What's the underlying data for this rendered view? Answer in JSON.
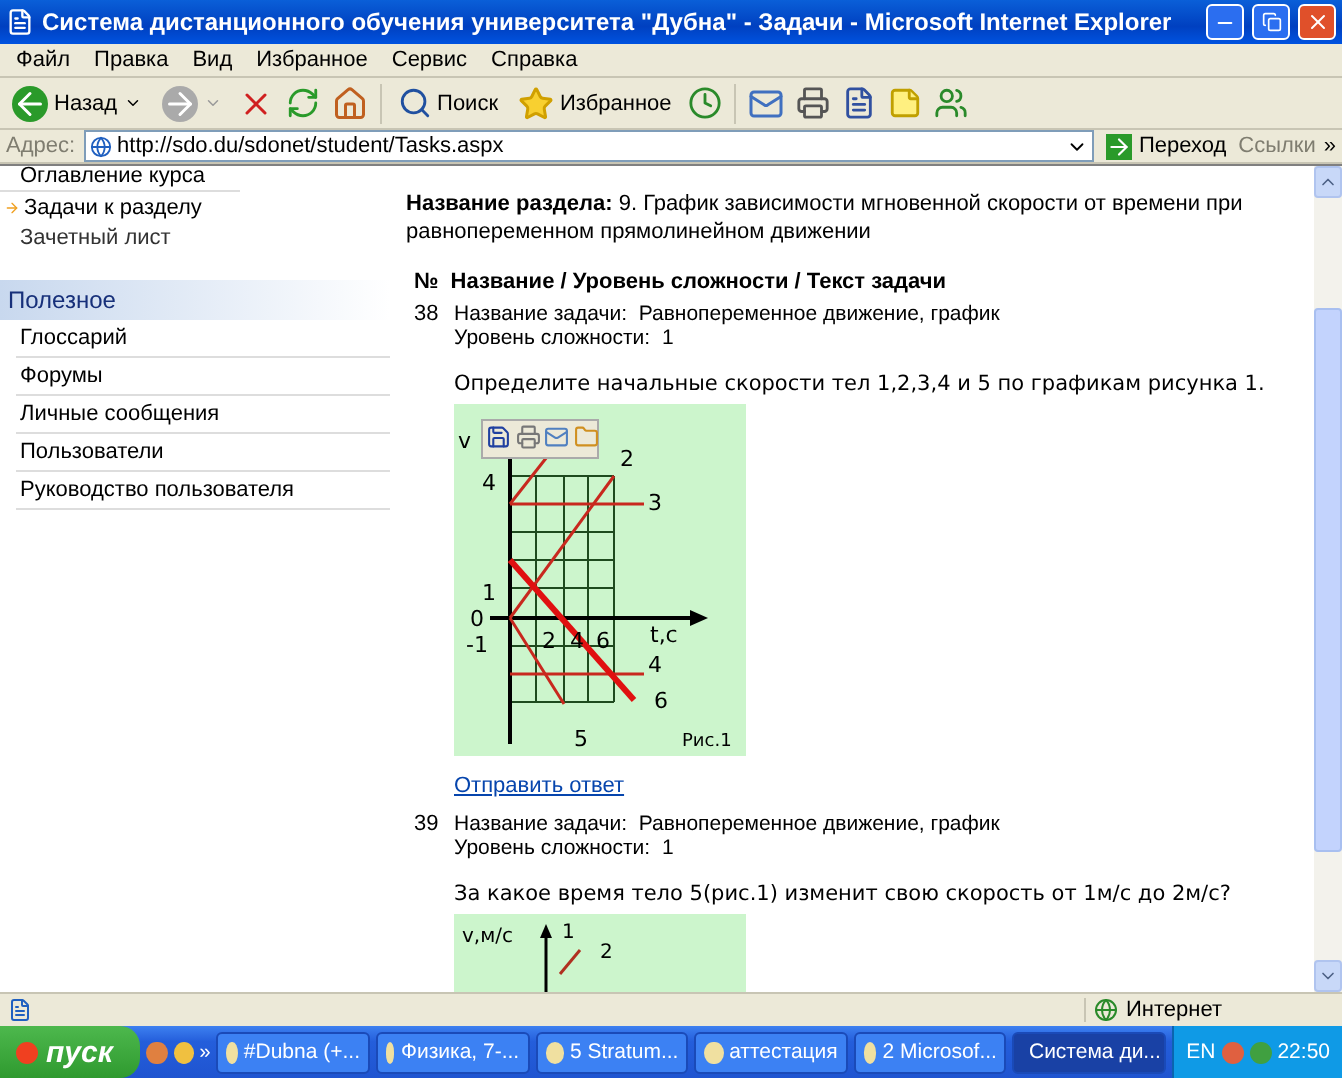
{
  "window": {
    "title": "Система дистанционного обучения университета \"Дубна\" - Задачи - Microsoft Internet Explorer"
  },
  "menu": [
    "Файл",
    "Правка",
    "Вид",
    "Избранное",
    "Сервис",
    "Справка"
  ],
  "toolbar": {
    "back": "Назад",
    "search": "Поиск",
    "favorites": "Избранное"
  },
  "address": {
    "label": "Адрес:",
    "value": "http://sdo.du/sdonet/student/Tasks.aspx",
    "go": "Переход",
    "links": "Ссылки",
    "more": "»"
  },
  "sidebar": {
    "top_item": "Оглавление курса",
    "items": [
      {
        "label": "Задачи к разделу",
        "selected": true
      },
      {
        "label": "Зачетный лист",
        "selected": false
      }
    ],
    "section": "Полезное",
    "links": [
      "Глоссарий",
      "Форумы",
      "Личные сообщения",
      "Пользователи",
      "Руководство пользователя"
    ]
  },
  "main": {
    "section": "**Название раздела:** 9. График зависимости мгновенной скорости от времени при равнопеременном прямолинейном движении",
    "columns": [
      "№",
      "Название / Уровень сложности / Текст задачи"
    ],
    "tasks": [
      {
        "number": "38",
        "name_label": "Название задачи:",
        "name": "Равнопеременное движение, график",
        "level_label": "Уровень сложности:",
        "level": "1",
        "question": "Определите начальные скорости тел 1,2,3,4 и 5 по графикам рисунка 1.",
        "figure": {
          "kind": "full",
          "labels": [
            "v",
            "4",
            "1",
            "0",
            "-1",
            "2",
            "4",
            "6",
            "t,c",
            "2",
            "3",
            "4",
            "6",
            "5",
            "Рис.1"
          ]
        },
        "answer_link": "Отправить ответ"
      },
      {
        "number": "39",
        "name_label": "Название задачи:",
        "name": "Равнопеременное движение, график",
        "level_label": "Уровень сложности:",
        "level": "1",
        "question": "За какое время тело 5(рис.1) изменит свою скорость от 1м/с до 2м/с?",
        "figure": {
          "kind": "partial",
          "labels": [
            "v,м/с",
            "1",
            "2"
          ]
        }
      }
    ]
  },
  "status_bar": {
    "zone": "Интернет"
  },
  "taskbar": {
    "start": "пуск",
    "more": "»",
    "tasks": [
      {
        "label": "#Dubna (+...",
        "selected": false
      },
      {
        "label": "Физика, 7-...",
        "selected": false
      },
      {
        "label": "5 Stratum...",
        "selected": false
      },
      {
        "label": "аттестация",
        "selected": false
      },
      {
        "label": "2 Microsof...",
        "selected": false
      },
      {
        "label": "Система ди...",
        "selected": true
      }
    ],
    "lang": "EN",
    "clock": "22:50"
  }
}
